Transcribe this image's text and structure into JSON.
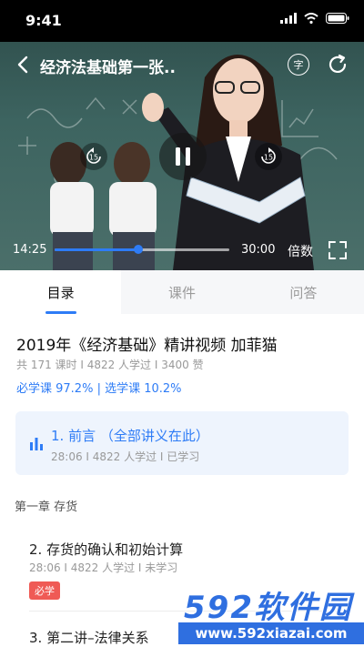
{
  "status_bar": {
    "time": "9:41"
  },
  "player": {
    "title": "经济法基础第一张..",
    "subtitle_glyph": "字",
    "current_time": "14:25",
    "total_time": "30:00",
    "progress": 0.48,
    "speed_label": "倍数",
    "skip_seconds": "15",
    "accent_color": "#2e7cf6"
  },
  "tabs": [
    {
      "label": "目录",
      "active": true
    },
    {
      "label": "课件",
      "active": false
    },
    {
      "label": "问答",
      "active": false
    }
  ],
  "course": {
    "title": "2019年《经济基础》精讲视频  加菲猫",
    "meta": "共 171 课时 I 4822 人学过 I 3400 赞",
    "progress_text": "必学课 97.2% | 选学课 10.2%"
  },
  "current_lesson": {
    "title": "1. 前言 （全部讲义在此）",
    "meta": "28:06 I 4822 人学过 I 已学习"
  },
  "chapter": {
    "label": "第一章 存货"
  },
  "lessons": [
    {
      "title": "2. 存货的确认和初始计算",
      "meta": "28:06 I 4822 人学过 I 未学习",
      "badge": "必学"
    },
    {
      "title": "3. 第二讲–法律关系"
    }
  ],
  "watermark": {
    "brand": "592软件园",
    "url": "www.592xiazai.com"
  }
}
